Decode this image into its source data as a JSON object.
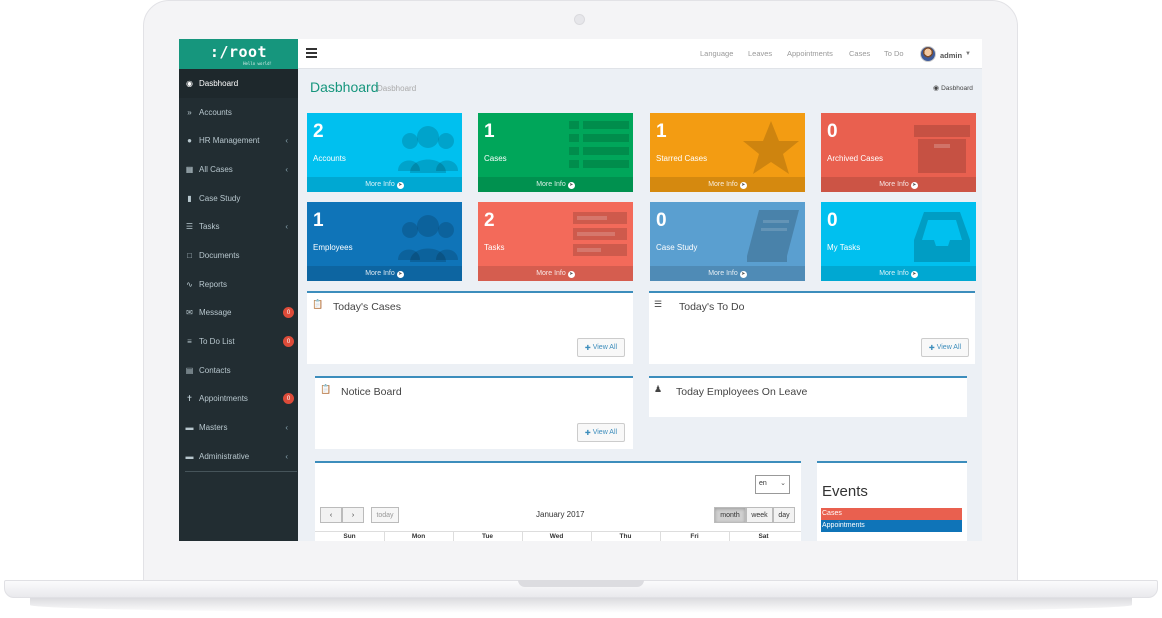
{
  "app": {
    "logo_text": ":/root",
    "logo_sub": "Hello world!"
  },
  "sidebar": {
    "items": [
      {
        "label": "Dasbhoard",
        "icon": "dashboard-icon"
      },
      {
        "label": "Accounts",
        "icon": "double-chevron-icon"
      },
      {
        "label": "HR Management",
        "icon": "users-icon"
      },
      {
        "label": "All Cases",
        "icon": "grid-icon"
      },
      {
        "label": "Case Study",
        "icon": "book-icon"
      },
      {
        "label": "Tasks",
        "icon": "list-icon"
      },
      {
        "label": "Documents",
        "icon": "file-icon"
      },
      {
        "label": "Reports",
        "icon": "line-chart-icon"
      },
      {
        "label": "Message",
        "icon": "envelope-icon",
        "badge": "0"
      },
      {
        "label": "To Do List",
        "icon": "bars-icon",
        "badge": "0"
      },
      {
        "label": "Contacts",
        "icon": "address-card-icon"
      },
      {
        "label": "Appointments",
        "icon": "pin-icon",
        "badge": "0"
      },
      {
        "label": "Masters",
        "icon": "folder-icon"
      },
      {
        "label": "Administrative",
        "icon": "folder-icon"
      }
    ]
  },
  "topnav": {
    "items": [
      "Language",
      "Leaves",
      "Appointments",
      "Cases",
      "To Do"
    ],
    "user": "admin"
  },
  "page": {
    "title": "Dasbhoard",
    "subtitle": "Dasbhoard",
    "breadcrumb": "Dasbhoard"
  },
  "boxes": [
    {
      "count": "2",
      "label": "Accounts",
      "footer": "More Info",
      "color": "#00c0ef",
      "icon": "users-icon"
    },
    {
      "count": "1",
      "label": "Cases",
      "footer": "More Info",
      "color": "#00a65a",
      "icon": "list-icon"
    },
    {
      "count": "1",
      "label": "Starred Cases",
      "footer": "More Info",
      "color": "#f39c12",
      "icon": "star-icon"
    },
    {
      "count": "0",
      "label": "Archived Cases",
      "footer": "More Info",
      "color": "#e9604f",
      "icon": "archive-icon"
    },
    {
      "count": "1",
      "label": "Employees",
      "footer": "More Info",
      "color": "#0f74b8",
      "icon": "users-icon"
    },
    {
      "count": "2",
      "label": "Tasks",
      "footer": "More Info",
      "color": "#f36a5a",
      "icon": "tasks-icon"
    },
    {
      "count": "0",
      "label": "Case Study",
      "footer": "More Info",
      "color": "#5a9fd0",
      "icon": "book-icon"
    },
    {
      "count": "0",
      "label": "My Tasks",
      "footer": "More Info",
      "color": "#00c0ef",
      "icon": "inbox-icon"
    }
  ],
  "panels": {
    "todays_cases": {
      "title": "Today's Cases",
      "button": "View All"
    },
    "todays_todo": {
      "title": "Today's To Do",
      "button": "View All"
    },
    "notice_board": {
      "title": "Notice Board",
      "button": "View All"
    },
    "leave": {
      "title": "Today Employees On Leave"
    }
  },
  "calendar": {
    "locale": "en",
    "today_label": "today",
    "month_title": "January 2017",
    "views": [
      "month",
      "week",
      "day"
    ],
    "days": [
      "Sun",
      "Mon",
      "Tue",
      "Wed",
      "Thu",
      "Fri",
      "Sat"
    ]
  },
  "events": {
    "title": "Events",
    "items": [
      {
        "label": "Cases",
        "color": "#e9604f"
      },
      {
        "label": "Appointments",
        "color": "#0f74b8"
      }
    ]
  }
}
